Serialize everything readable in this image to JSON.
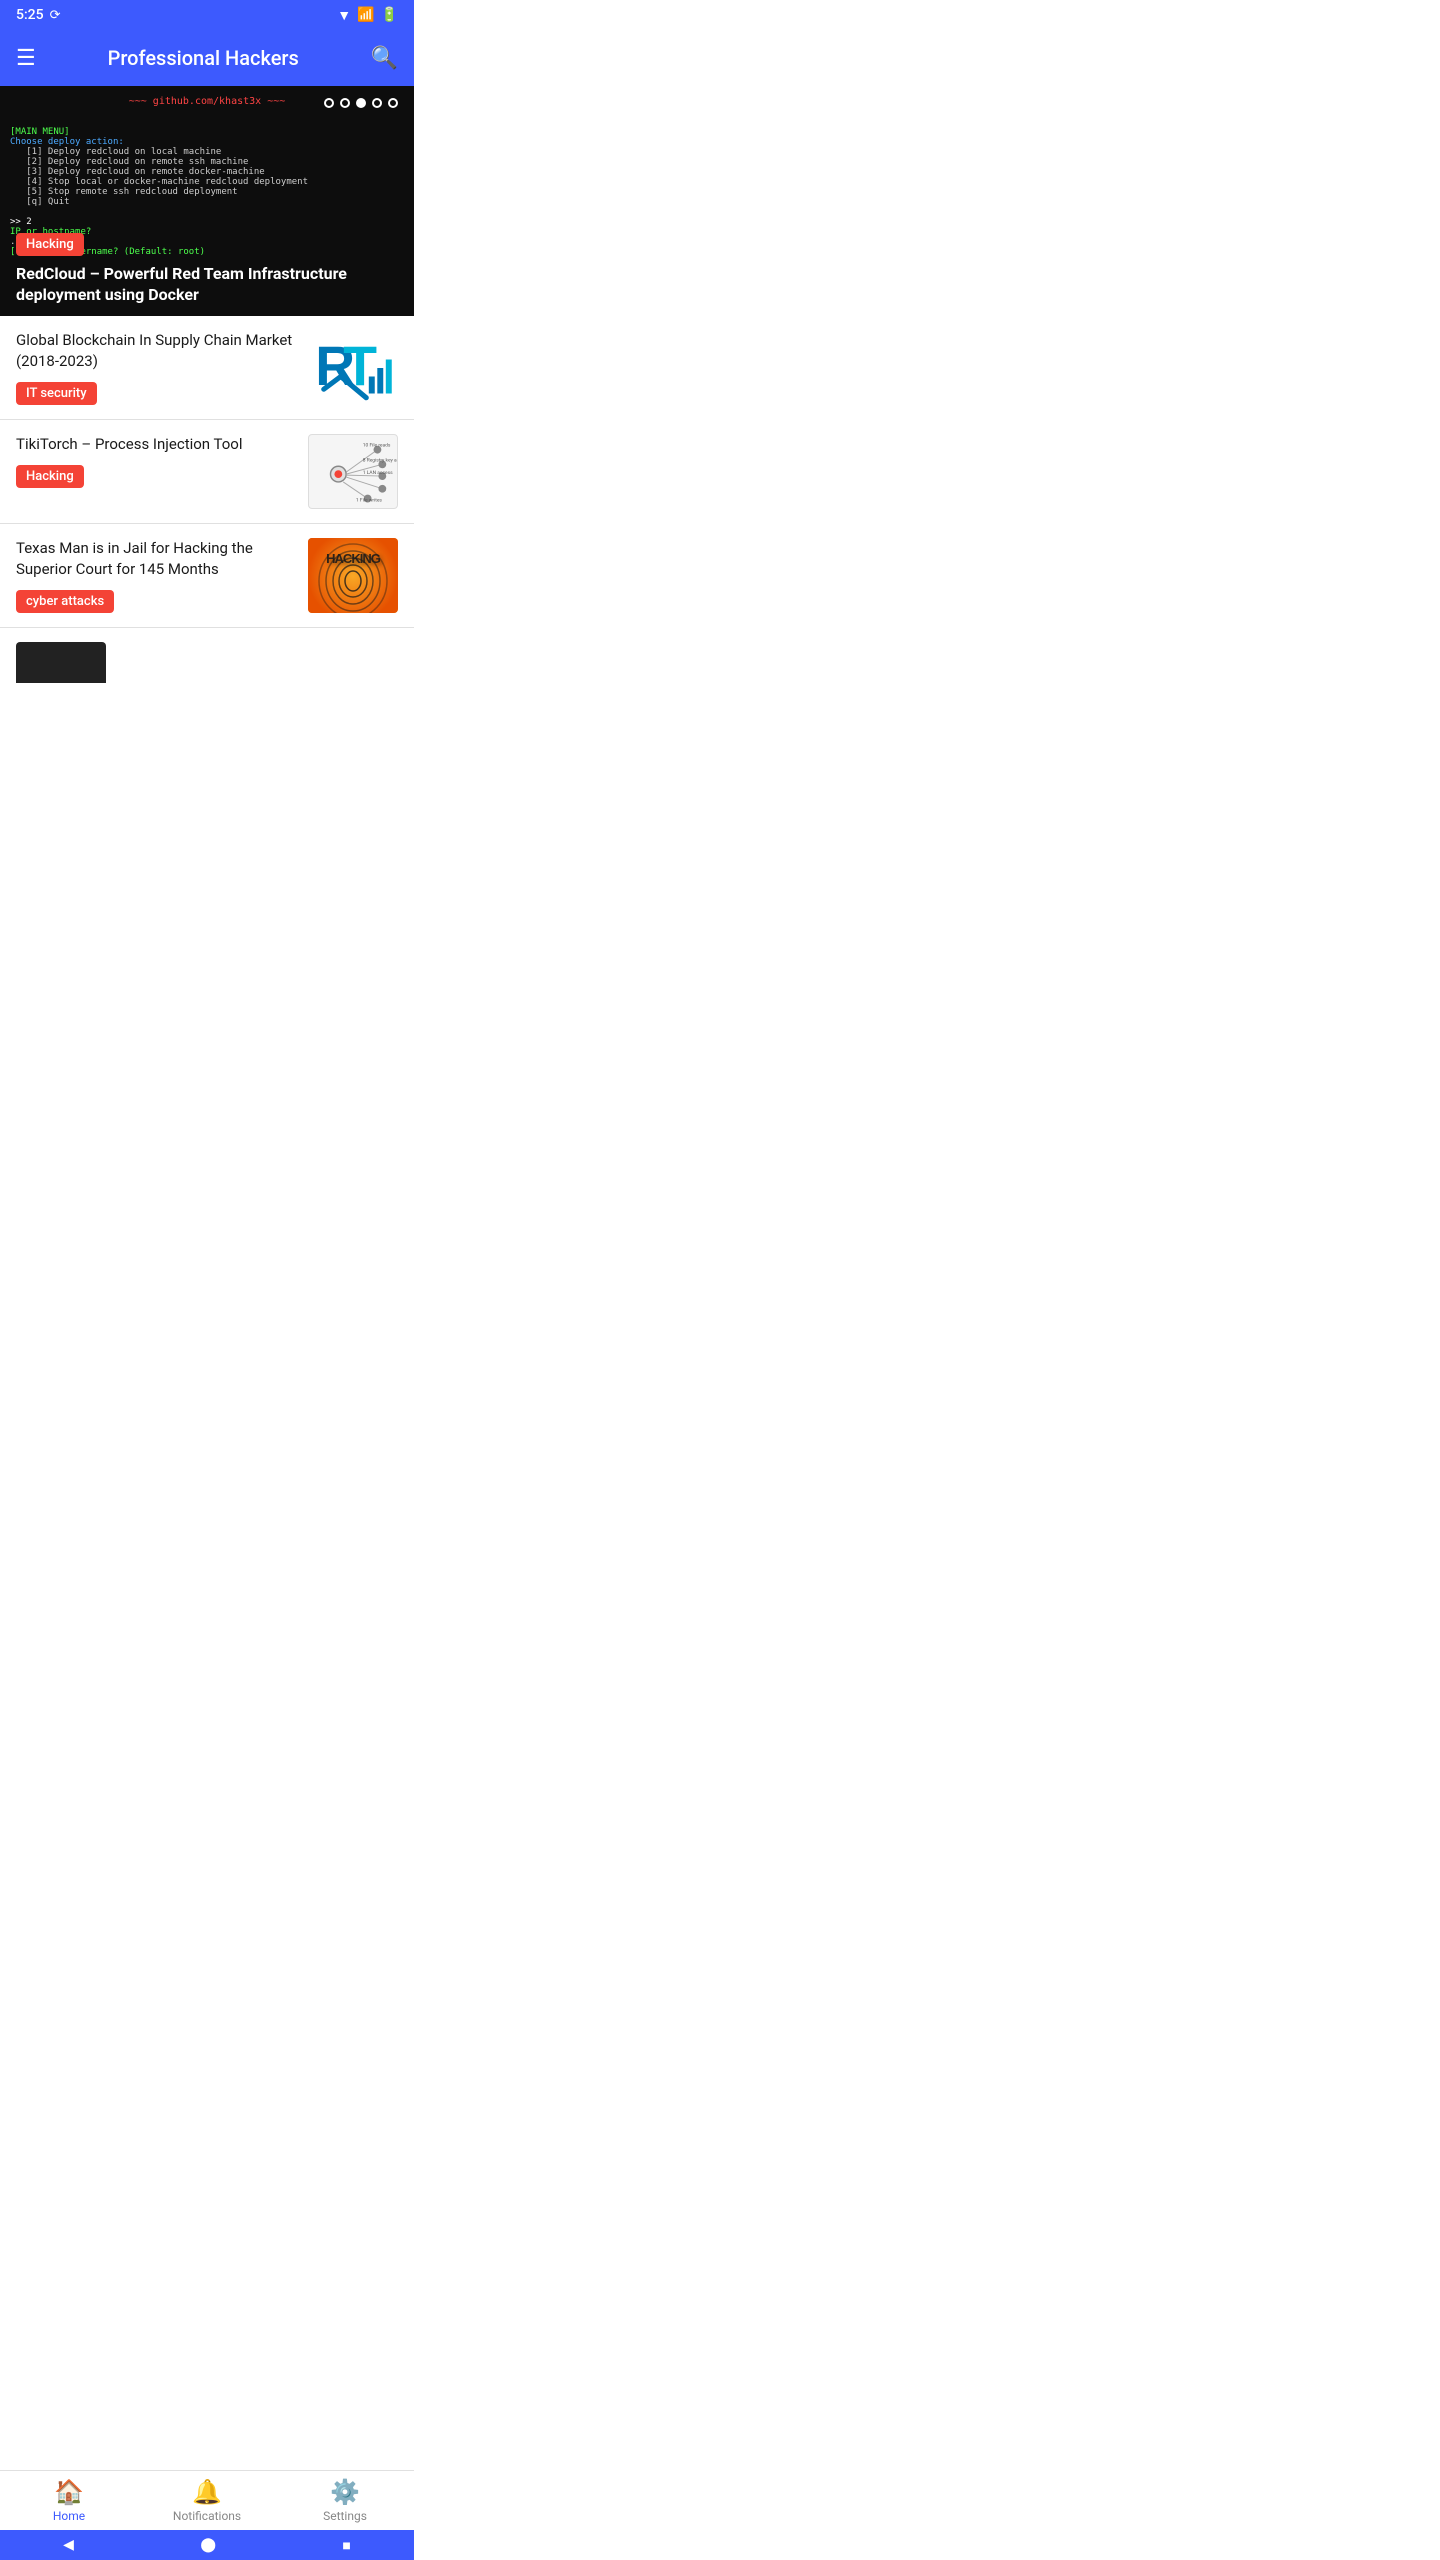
{
  "statusBar": {
    "time": "5:25",
    "icons": [
      "signal",
      "battery"
    ]
  },
  "appBar": {
    "title": "Professional Hackers",
    "menuIcon": "☰",
    "searchIcon": "🔍"
  },
  "heroBanner": {
    "category": "Hacking",
    "title": "RedCloud – Powerful Red Team Infrastructure deployment using Docker",
    "githubText": "~~~ github.com/khast3x ~~~",
    "dots": [
      false,
      false,
      true,
      false,
      false
    ],
    "terminalLines": [
      "[MAIN MENU]",
      "Choose deploy action:",
      "[1] Deploy redcloud on local machine",
      "[2] Deploy redcloud on remote ssh machine",
      "[3] Deploy redcloud on remote docker-machine",
      "[4] Stop local or docker-machine redcloud deployment",
      "[5] Stop remote ssh redcloud deployment",
      "[q] Quit",
      "",
      ">> 2",
      "IP or hostname?",
      ".157",
      "[?] Target username? (Default: root)"
    ]
  },
  "articles": [
    {
      "title": "Global Blockchain In Supply Chain Market (2018-2023)",
      "category": "IT security",
      "categoryClass": "badge-it-security",
      "thumbType": "rt-logo"
    },
    {
      "title": "TikiTorch – Process Injection Tool",
      "category": "Hacking",
      "categoryClass": "badge-hacking",
      "thumbType": "tikitorch"
    },
    {
      "title": "Texas Man is in Jail for Hacking the Superior Court for 145 Months",
      "category": "cyber attacks",
      "categoryClass": "badge-cyber",
      "thumbType": "hacking"
    }
  ],
  "bottomNav": [
    {
      "id": "home",
      "label": "Home",
      "icon": "🏠",
      "active": true
    },
    {
      "id": "notifications",
      "label": "Notifications",
      "icon": "🔔",
      "active": false
    },
    {
      "id": "settings",
      "label": "Settings",
      "icon": "⚙️",
      "active": false
    }
  ],
  "androidNav": {
    "back": "◀",
    "home": "⬤",
    "recents": "■"
  }
}
